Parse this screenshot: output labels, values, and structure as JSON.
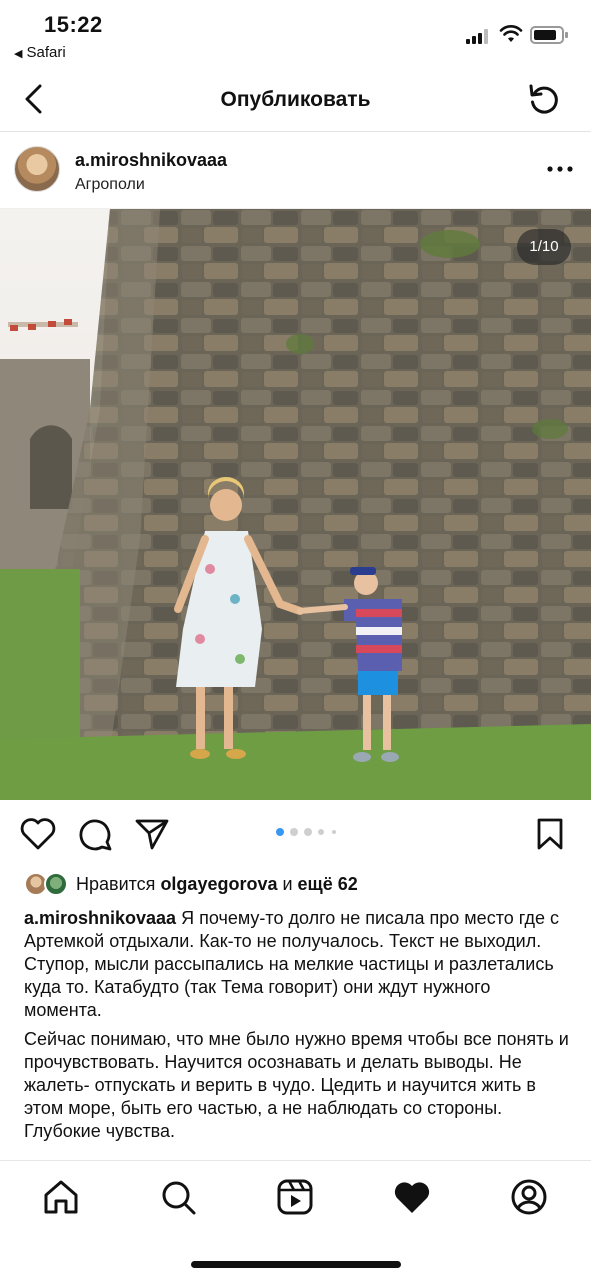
{
  "status_bar": {
    "time": "15:22",
    "back_app": "Safari"
  },
  "nav": {
    "title": "Опубликовать",
    "back_icon": "chevron-left-icon",
    "refresh_icon": "refresh-icon"
  },
  "post": {
    "username": "a.miroshnikovaaa",
    "location": "Агрополи",
    "more_icon": "more-dots-icon",
    "photo_counter": "1/10",
    "carousel_total": 5,
    "carousel_active": 1
  },
  "actions": {
    "like_icon": "heart-outline-icon",
    "comment_icon": "comment-icon",
    "share_icon": "send-icon",
    "save_icon": "bookmark-icon"
  },
  "likes": {
    "prefix": "Нравится ",
    "user": "olgayegorova",
    "middle": " и ",
    "others": "ещё 62"
  },
  "caption": {
    "username": "a.miroshnikovaaa",
    "paragraph1": " Я почему-то долго не писала про место где с Артемкой отдыхали. Как-то не получалось. Текст не выходил. Ступор, мысли рассыпались на мелкие частицы и разлетались куда то. Катабудто (так Тема говорит) они ждут нужного момента.",
    "paragraph2": "Сейчас понимаю, что мне было нужно время чтобы все понять и прочувствовать. Научится осознавать и делать выводы. Не жалеть- отпускать и верить в чудо. Цедить и научится жить в этом море, быть его частью, а не наблюдать со стороны. Глубокие чувства."
  },
  "tabbar": {
    "items": [
      {
        "icon": "home-icon"
      },
      {
        "icon": "search-icon"
      },
      {
        "icon": "reels-icon"
      },
      {
        "icon": "heart-filled-icon"
      },
      {
        "icon": "profile-icon"
      }
    ]
  },
  "colors": {
    "text": "#111111",
    "divider": "#e4e4e4",
    "active_dot": "#3897f0",
    "inactive_dot": "#cfcfcf"
  }
}
